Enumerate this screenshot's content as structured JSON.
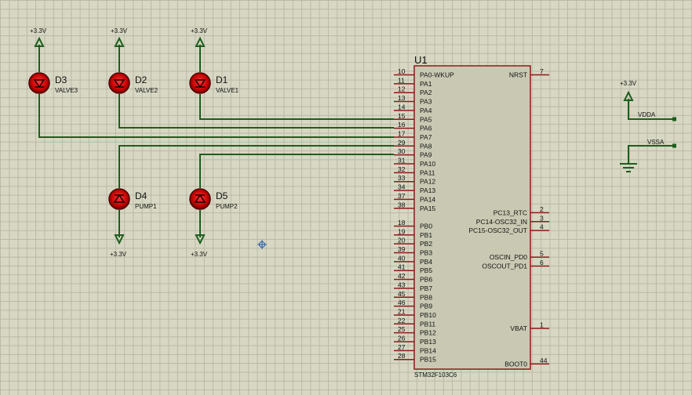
{
  "ic": {
    "ref": "U1",
    "part": "STM32F103C6",
    "left_pins": [
      {
        "num": "10",
        "name": "PA0-WKUP"
      },
      {
        "num": "11",
        "name": "PA1"
      },
      {
        "num": "12",
        "name": "PA2"
      },
      {
        "num": "13",
        "name": "PA3"
      },
      {
        "num": "14",
        "name": "PA4"
      },
      {
        "num": "15",
        "name": "PA5"
      },
      {
        "num": "16",
        "name": "PA6"
      },
      {
        "num": "17",
        "name": "PA7"
      },
      {
        "num": "29",
        "name": "PA8"
      },
      {
        "num": "30",
        "name": "PA9"
      },
      {
        "num": "31",
        "name": "PA10"
      },
      {
        "num": "32",
        "name": "PA11"
      },
      {
        "num": "33",
        "name": "PA12"
      },
      {
        "num": "34",
        "name": "PA13"
      },
      {
        "num": "37",
        "name": "PA14"
      },
      {
        "num": "38",
        "name": "PA15"
      },
      {
        "num": "18",
        "name": "PB0"
      },
      {
        "num": "19",
        "name": "PB1"
      },
      {
        "num": "20",
        "name": "PB2"
      },
      {
        "num": "39",
        "name": "PB3"
      },
      {
        "num": "40",
        "name": "PB4"
      },
      {
        "num": "41",
        "name": "PB5"
      },
      {
        "num": "42",
        "name": "PB6"
      },
      {
        "num": "43",
        "name": "PB7"
      },
      {
        "num": "45",
        "name": "PB8"
      },
      {
        "num": "46",
        "name": "PB9"
      },
      {
        "num": "21",
        "name": "PB10"
      },
      {
        "num": "22",
        "name": "PB11"
      },
      {
        "num": "25",
        "name": "PB12"
      },
      {
        "num": "26",
        "name": "PB13"
      },
      {
        "num": "27",
        "name": "PB14"
      },
      {
        "num": "28",
        "name": "PB15"
      }
    ],
    "right_pins": [
      {
        "num": "7",
        "name": "NRST"
      },
      {
        "num": "2",
        "name": "PC13_RTC"
      },
      {
        "num": "3",
        "name": "PC14-OSC32_IN"
      },
      {
        "num": "4",
        "name": "PC15-OSC32_OUT"
      },
      {
        "num": "5",
        "name": "OSCIN_PD0"
      },
      {
        "num": "6",
        "name": "OSCOUT_PD1"
      },
      {
        "num": "1",
        "name": "VBAT"
      },
      {
        "num": "44",
        "name": "BOOT0"
      }
    ]
  },
  "leds": [
    {
      "ref": "D3",
      "value": "VALVE3",
      "power": "+3.3V"
    },
    {
      "ref": "D2",
      "value": "VALVE2",
      "power": "+3.3V"
    },
    {
      "ref": "D1",
      "value": "VALVE1",
      "power": "+3.3V"
    },
    {
      "ref": "D4",
      "value": "PUMP1",
      "power": "+3.3V"
    },
    {
      "ref": "D5",
      "value": "PUMP2",
      "power": "+3.3V"
    }
  ],
  "power_section": {
    "supply_label": "+3.3V",
    "vdda_label": "VDDA",
    "vssa_label": "VSSA"
  },
  "colors": {
    "wire": "#1d5e1d",
    "component": "#8b1a1a",
    "ic_fill": "#c9c9b3",
    "led_fill": "#cc0000"
  }
}
